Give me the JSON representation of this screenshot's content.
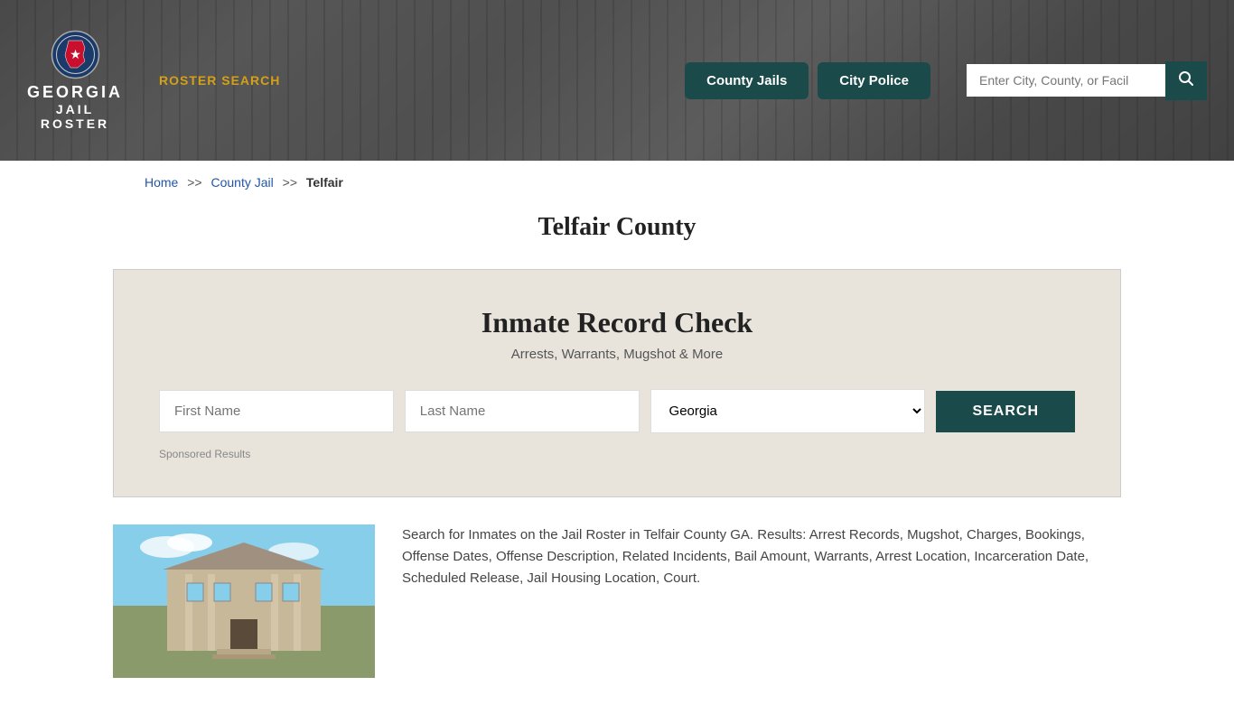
{
  "header": {
    "logo_georgia": "GEORGIA",
    "logo_jail": "JAIL",
    "logo_roster": "ROSTER",
    "nav_roster_search": "ROSTER SEARCH",
    "btn_county_jails": "County Jails",
    "btn_city_police": "City Police",
    "search_placeholder": "Enter City, County, or Facil"
  },
  "breadcrumb": {
    "home": "Home",
    "separator1": ">>",
    "county_jail": "County Jail",
    "separator2": ">>",
    "current": "Telfair"
  },
  "page": {
    "title": "Telfair County"
  },
  "inmate_section": {
    "title": "Inmate Record Check",
    "subtitle": "Arrests, Warrants, Mugshot & More",
    "first_name_placeholder": "First Name",
    "last_name_placeholder": "Last Name",
    "state_default": "Georgia",
    "search_btn": "SEARCH",
    "sponsored": "Sponsored Results"
  },
  "bottom": {
    "description": "Search for Inmates on the Jail Roster in Telfair County GA. Results: Arrest Records, Mugshot, Charges, Bookings, Offense Dates, Offense Description, Related Incidents, Bail Amount, Warrants, Arrest Location, Incarceration Date, Scheduled Release, Jail Housing Location, Court."
  }
}
